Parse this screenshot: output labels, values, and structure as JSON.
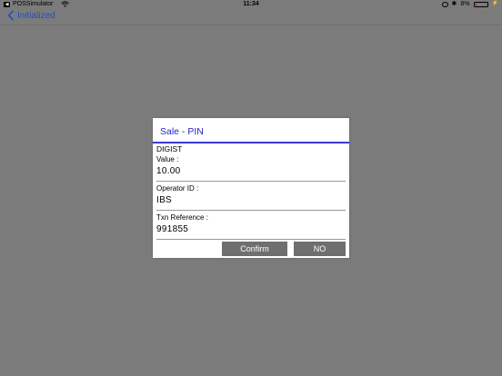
{
  "status_bar": {
    "app_back_label": "POSSimulator",
    "time": "11:34",
    "battery_percent": "8%",
    "battery_level": 0.08,
    "battery_color": "#d0021b"
  },
  "nav": {
    "back_label": "Initialized",
    "accent_color": "#1f4fc6"
  },
  "dialog": {
    "title": "Sale - PIN",
    "merchant": "DIGIST",
    "fields": [
      {
        "label": "Value :",
        "value": "10.00"
      },
      {
        "label": "Operator ID :",
        "value": "IBS"
      },
      {
        "label": "Txn Reference :",
        "value": "991855"
      }
    ],
    "confirm_label": "Confirm",
    "no_label": "NO"
  }
}
